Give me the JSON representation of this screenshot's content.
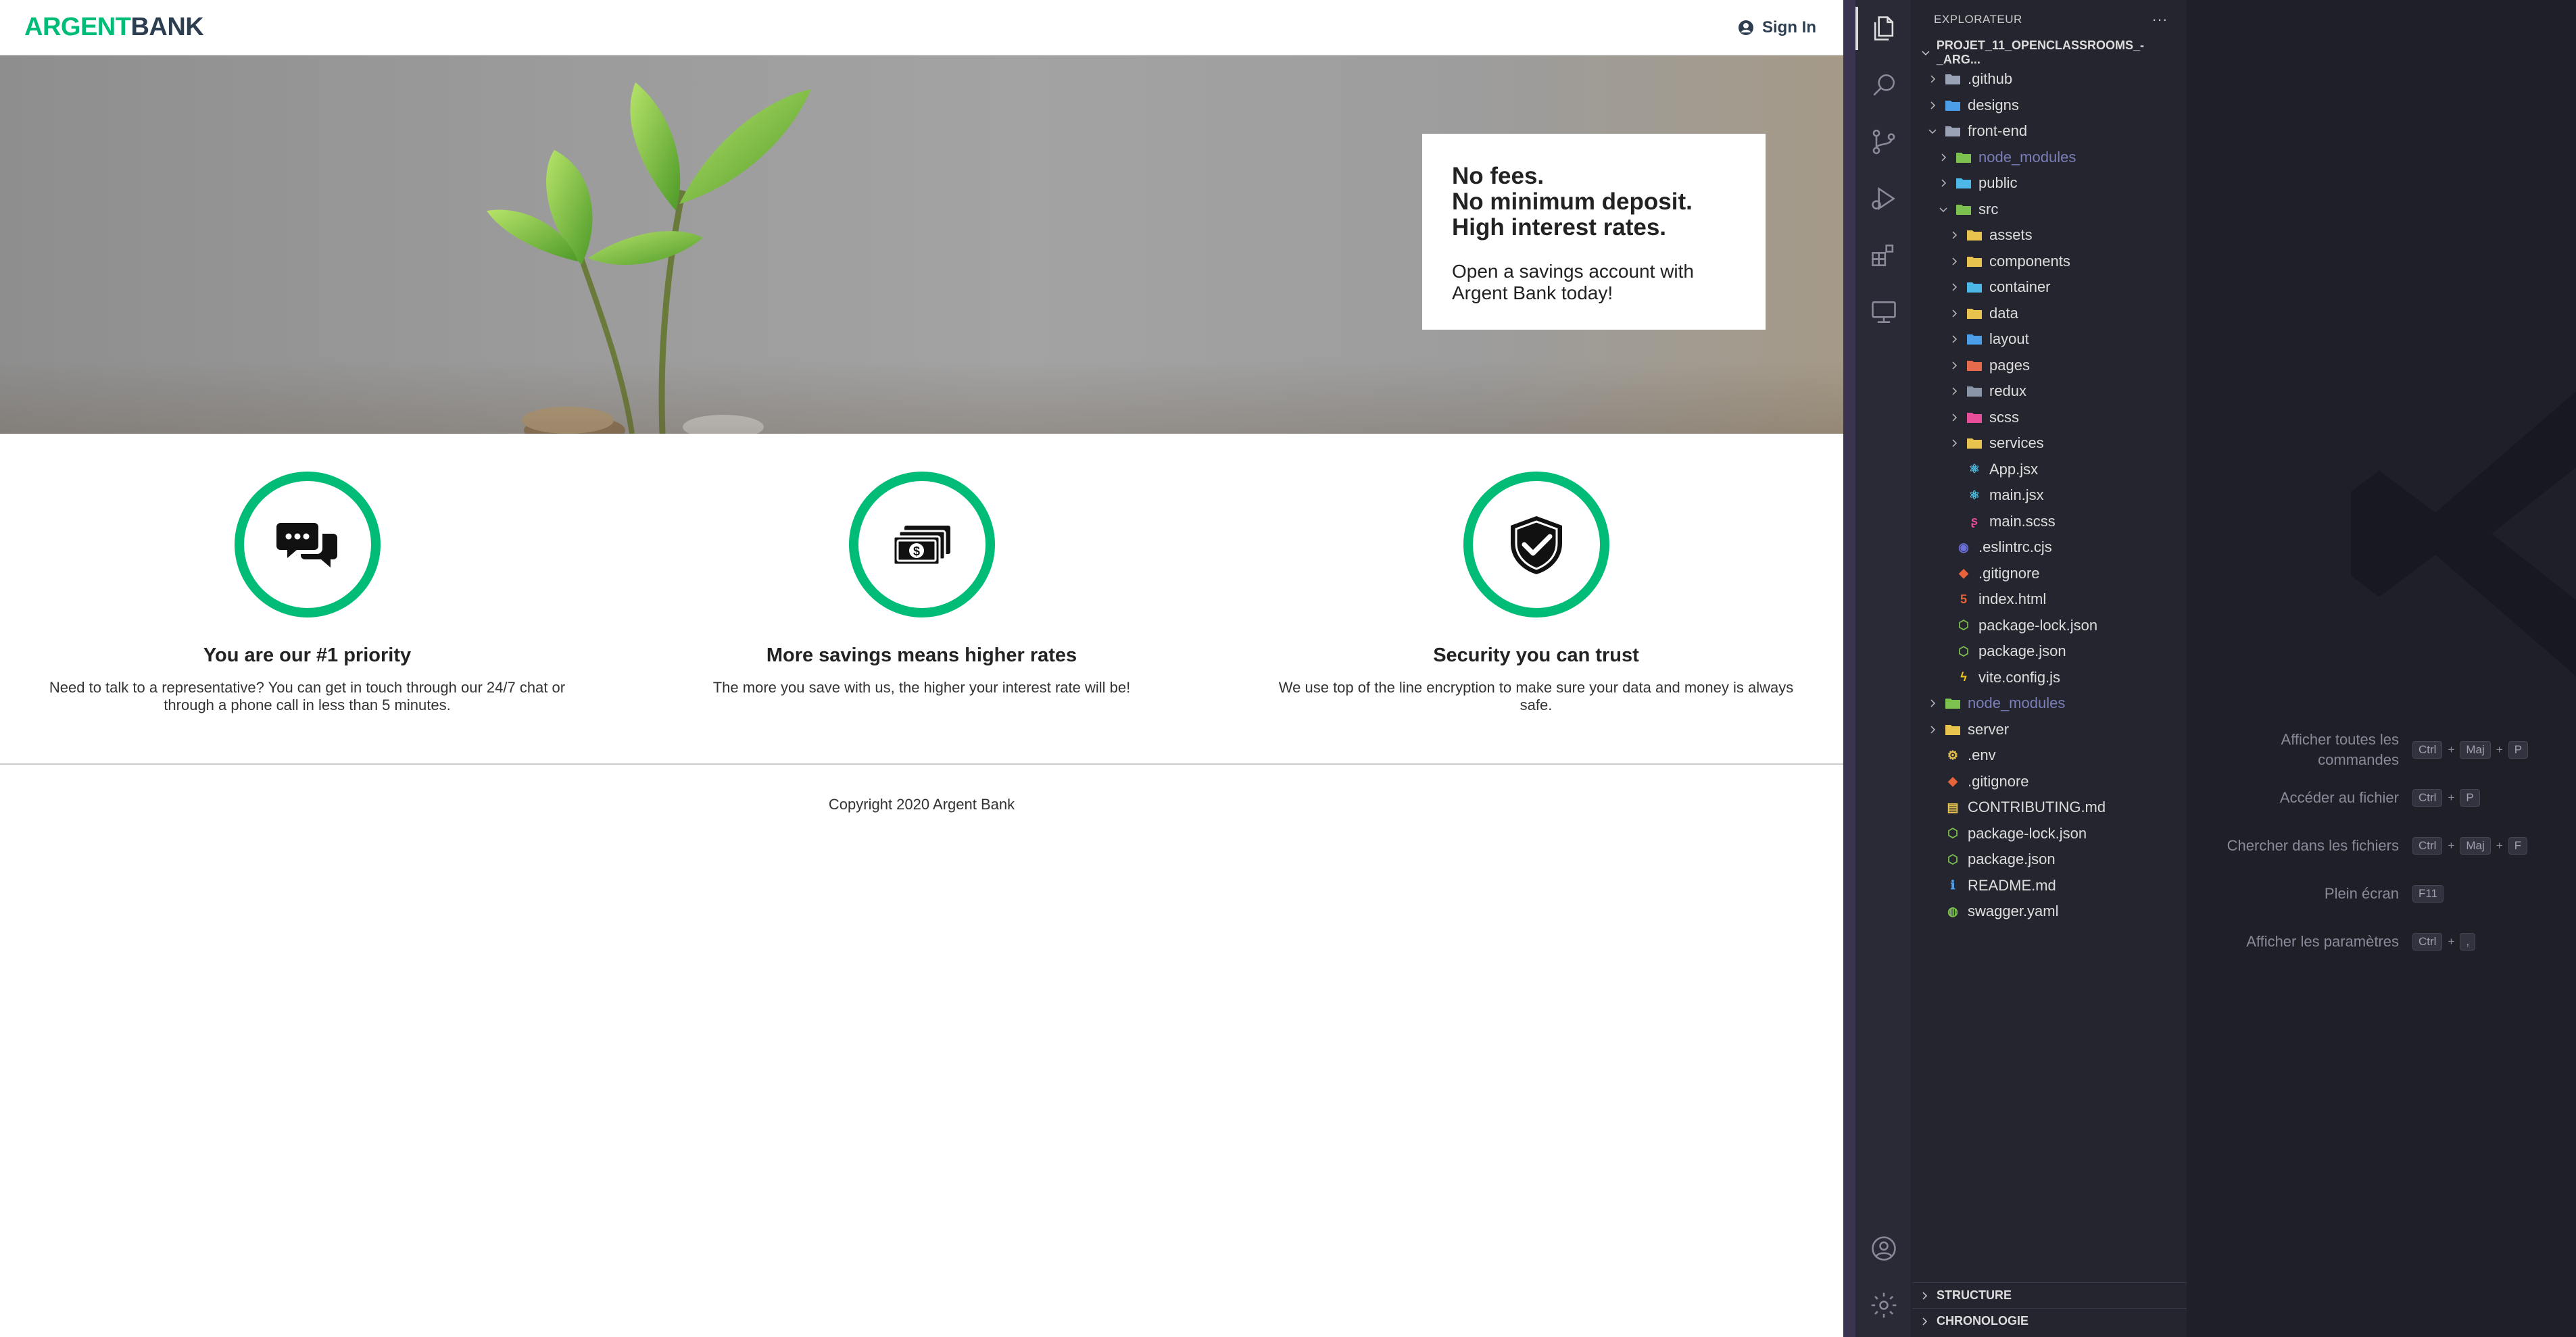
{
  "app": {
    "logo_part1": "ARGENT",
    "logo_part2": "BANK",
    "signin": "Sign In",
    "hero": {
      "line1": "No fees.",
      "line2": "No minimum deposit.",
      "line3": "High interest rates.",
      "text": "Open a savings account with Argent Bank today!"
    },
    "features": [
      {
        "title": "You are our #1 priority",
        "text": "Need to talk to a representative? You can get in touch through our 24/7 chat or through a phone call in less than 5 minutes.",
        "icon": "chat-icon"
      },
      {
        "title": "More savings means higher rates",
        "text": "The more you save with us, the higher your interest rate will be!",
        "icon": "money-icon"
      },
      {
        "title": "Security you can trust",
        "text": "We use top of the line encryption to make sure your data and money is always safe.",
        "icon": "security-icon"
      }
    ],
    "footer": "Copyright 2020 Argent Bank",
    "colors": {
      "accent": "#00bc77",
      "dark": "#2c3e50"
    }
  },
  "vscode": {
    "explorer_title": "EXPLORATEUR",
    "more": "···",
    "project": "PROJET_11_OPENCLASSROOMS_-_ARG...",
    "tree": [
      {
        "label": ".github",
        "depth": 0,
        "chev": "right",
        "icon": "folder-github",
        "color": "#9aa3b5"
      },
      {
        "label": "designs",
        "depth": 0,
        "chev": "right",
        "icon": "folder-blue",
        "color": "#4d9ee8"
      },
      {
        "label": "front-end",
        "depth": 0,
        "chev": "down",
        "icon": "folder-open",
        "color": "#9aa3b5"
      },
      {
        "label": "node_modules",
        "depth": 1,
        "chev": "right",
        "icon": "folder-green",
        "color": "#7cc14f",
        "dim": true
      },
      {
        "label": "public",
        "depth": 1,
        "chev": "right",
        "icon": "folder-blue",
        "color": "#4db7e8"
      },
      {
        "label": "src",
        "depth": 1,
        "chev": "down",
        "icon": "folder-green",
        "color": "#7cc14f"
      },
      {
        "label": "assets",
        "depth": 2,
        "chev": "right",
        "icon": "folder-yellow",
        "color": "#e8c34d"
      },
      {
        "label": "components",
        "depth": 2,
        "chev": "right",
        "icon": "folder-yellow",
        "color": "#e8c34d"
      },
      {
        "label": "container",
        "depth": 2,
        "chev": "right",
        "icon": "folder-blue",
        "color": "#4db7e8"
      },
      {
        "label": "data",
        "depth": 2,
        "chev": "right",
        "icon": "folder-yellow",
        "color": "#e8c34d"
      },
      {
        "label": "layout",
        "depth": 2,
        "chev": "right",
        "icon": "folder-blue",
        "color": "#4d9ee8"
      },
      {
        "label": "pages",
        "depth": 2,
        "chev": "right",
        "icon": "folder-red",
        "color": "#e86a4d"
      },
      {
        "label": "redux",
        "depth": 2,
        "chev": "right",
        "icon": "folder-gray",
        "color": "#8a96a8"
      },
      {
        "label": "scss",
        "depth": 2,
        "chev": "right",
        "icon": "folder-pink",
        "color": "#e84d9a"
      },
      {
        "label": "services",
        "depth": 2,
        "chev": "right",
        "icon": "folder-yellow",
        "color": "#e8c34d"
      },
      {
        "label": "App.jsx",
        "depth": 2,
        "chev": "none",
        "icon": "react-icon",
        "color": "#4dc3e8",
        "glyph": "⚛"
      },
      {
        "label": "main.jsx",
        "depth": 2,
        "chev": "none",
        "icon": "react-icon",
        "color": "#4dc3e8",
        "glyph": "⚛"
      },
      {
        "label": "main.scss",
        "depth": 2,
        "chev": "none",
        "icon": "sass-icon",
        "color": "#e84d9a",
        "glyph": "ʂ"
      },
      {
        "label": ".eslintrc.cjs",
        "depth": 1,
        "chev": "none",
        "icon": "eslint-icon",
        "color": "#6b6fd8",
        "glyph": "◉"
      },
      {
        "label": ".gitignore",
        "depth": 1,
        "chev": "none",
        "icon": "git-icon",
        "color": "#e8623a",
        "glyph": "◆"
      },
      {
        "label": "index.html",
        "depth": 1,
        "chev": "none",
        "icon": "html-icon",
        "color": "#e8623a",
        "glyph": "5"
      },
      {
        "label": "package-lock.json",
        "depth": 1,
        "chev": "none",
        "icon": "node-icon",
        "color": "#7cc14f",
        "glyph": "⬡"
      },
      {
        "label": "package.json",
        "depth": 1,
        "chev": "none",
        "icon": "node-icon",
        "color": "#7cc14f",
        "glyph": "⬡"
      },
      {
        "label": "vite.config.js",
        "depth": 1,
        "chev": "none",
        "icon": "vite-icon",
        "color": "#f5c518",
        "glyph": "ϟ"
      },
      {
        "label": "node_modules",
        "depth": 0,
        "chev": "right",
        "icon": "folder-green",
        "color": "#7cc14f",
        "dim": true
      },
      {
        "label": "server",
        "depth": 0,
        "chev": "right",
        "icon": "folder-yellow",
        "color": "#e8c34d"
      },
      {
        "label": ".env",
        "depth": 0,
        "chev": "none",
        "icon": "env-icon",
        "color": "#e8c34d",
        "glyph": "⚙"
      },
      {
        "label": ".gitignore",
        "depth": 0,
        "chev": "none",
        "icon": "git-icon",
        "color": "#e8623a",
        "glyph": "◆"
      },
      {
        "label": "CONTRIBUTING.md",
        "depth": 0,
        "chev": "none",
        "icon": "markdown-icon",
        "color": "#e8c34d",
        "glyph": "▤"
      },
      {
        "label": "package-lock.json",
        "depth": 0,
        "chev": "none",
        "icon": "node-icon",
        "color": "#7cc14f",
        "glyph": "⬡"
      },
      {
        "label": "package.json",
        "depth": 0,
        "chev": "none",
        "icon": "node-icon",
        "color": "#7cc14f",
        "glyph": "⬡"
      },
      {
        "label": "README.md",
        "depth": 0,
        "chev": "none",
        "icon": "info-icon",
        "color": "#4d9ee8",
        "glyph": "ℹ"
      },
      {
        "label": "swagger.yaml",
        "depth": 0,
        "chev": "none",
        "icon": "swagger-icon",
        "color": "#7cc14f",
        "glyph": "◍"
      }
    ],
    "structure": "STRUCTURE",
    "timeline": "CHRONOLOGIE",
    "shortcuts": [
      {
        "name": "Afficher toutes les commandes",
        "keys": [
          "Ctrl",
          "Maj",
          "P"
        ]
      },
      {
        "name": "Accéder au fichier",
        "keys": [
          "Ctrl",
          "P"
        ]
      },
      {
        "name": "Chercher dans les fichiers",
        "keys": [
          "Ctrl",
          "Maj",
          "F"
        ]
      },
      {
        "name": "Plein écran",
        "keys": [
          "F11"
        ]
      },
      {
        "name": "Afficher les paramètres",
        "keys": [
          "Ctrl",
          ","
        ]
      }
    ]
  }
}
